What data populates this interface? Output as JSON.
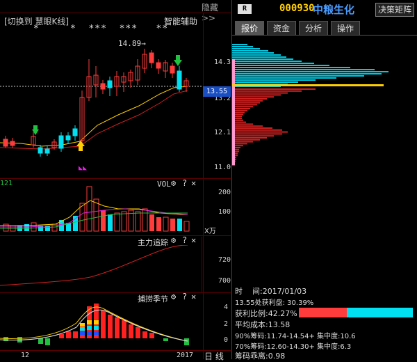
{
  "header": {
    "switch_label": "[切换到 慧眼K线]",
    "smart_assist": "智能辅助",
    "hide_label": "隐藏>>",
    "r_badge": "R",
    "stock_code": "000930",
    "stock_name": "中粮生化",
    "decision_button": "决策矩阵"
  },
  "tabs": [
    {
      "label": "报价",
      "active": true
    },
    {
      "label": "资金",
      "active": false
    },
    {
      "label": "分析",
      "active": false
    },
    {
      "label": "操作",
      "active": false
    }
  ],
  "kline": {
    "stars": "*     *  ***  ***   **",
    "high_marker": "14.89→",
    "y_labels": [
      "14.3",
      "13.2",
      "12.1",
      "11.0"
    ],
    "current_price": "13.55"
  },
  "vol_panel": {
    "title": "VOL",
    "corner": "121",
    "y_labels": [
      "200",
      "100"
    ],
    "unit": "X万"
  },
  "fund_panel": {
    "title": "主力追踪",
    "y_labels": [
      "720",
      "700"
    ]
  },
  "season_panel": {
    "title": "捕捞季节",
    "y_labels": [
      "4",
      "2",
      "0"
    ]
  },
  "bottom": {
    "x_label_1": "12",
    "x_label_2": "2017",
    "period_label": "日 线"
  },
  "chip_info": {
    "time_label": "时    间:2017/01/03",
    "profit_line": "13.55处获利盘: 30.39%",
    "profit_ratio_label": "获利比例:42.27%",
    "profit_ratio": 0.4227,
    "avg_cost": "平均成本:13.58",
    "chip90": "90%筹码:11.74-14.54+ 集中度:10.6",
    "chip70": "70%筹码:12.60-14.30+ 集中度:6.3",
    "deviation": "筹码乖离:0.98"
  },
  "colors": {
    "up": "#ff3c3c",
    "down": "#00e0f0",
    "accent_yellow": "#ffd000",
    "brand_blue": "#4a9cff"
  }
}
